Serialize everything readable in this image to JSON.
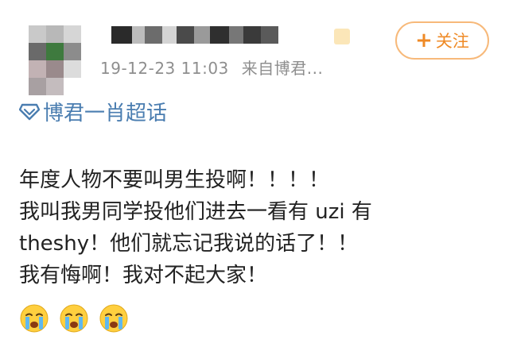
{
  "post": {
    "meta": {
      "timestamp": "19-12-23 11:03",
      "source": "来自博君..."
    },
    "follow_button": {
      "plus": "+",
      "label": "关注"
    },
    "topic": {
      "icon": "diamond-icon",
      "label": "博君一肖超话"
    },
    "content": {
      "lines": [
        "年度人物不要叫男生投啊！！！！",
        "我叫我男同学投他们进去一看有 uzi 有",
        "theshy！他们就忘记我说的话了！！",
        "我有悔啊！我对不起大家！"
      ]
    },
    "emojis": [
      "crying-face-icon",
      "crying-face-icon",
      "crying-face-icon"
    ],
    "colors": {
      "accent_orange": "#ef8a26",
      "follow_border": "#f7b97a",
      "topic_blue": "#4a7db0",
      "meta_gray": "#8e8e8e"
    }
  }
}
